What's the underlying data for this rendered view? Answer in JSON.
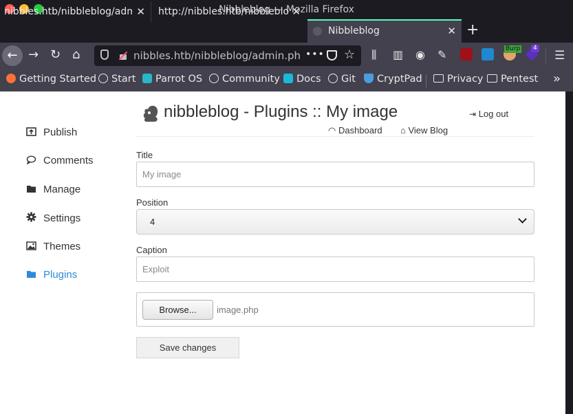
{
  "window": {
    "title": "Nibbleblog — Mozilla Firefox"
  },
  "tabs": [
    {
      "label": "nibbles.htb/nibbleblog/admin.php"
    },
    {
      "label": "http://nibbles.htb/nibbleblog/admin.php"
    },
    {
      "label": "Nibbleblog",
      "active": true
    }
  ],
  "navbar": {
    "url": "nibbles.htb/nibbleblog/admin.php?controller=plugins&action=config&plugin=my_image",
    "more": "•••",
    "burp_label": "Burp",
    "ext_badge": "4"
  },
  "bookmarks": [
    {
      "label": "Getting Started",
      "icon": "firefox-icon"
    },
    {
      "label": "Start",
      "icon": "globe-icon"
    },
    {
      "label": "Parrot OS",
      "icon": "parrot-icon"
    },
    {
      "label": "Community",
      "icon": "globe-icon"
    },
    {
      "label": "Docs",
      "icon": "docs-icon"
    },
    {
      "label": "Git",
      "icon": "globe-icon"
    },
    {
      "label": "CryptPad",
      "icon": "cryptpad-icon"
    },
    {
      "label": "Privacy",
      "icon": "folder-icon"
    },
    {
      "label": "Pentest",
      "icon": "folder-icon"
    }
  ],
  "sidebar": {
    "items": [
      {
        "label": "Publish",
        "icon": "publish-icon"
      },
      {
        "label": "Comments",
        "icon": "comment-icon"
      },
      {
        "label": "Manage",
        "icon": "folder-icon"
      },
      {
        "label": "Settings",
        "icon": "gear-icon"
      },
      {
        "label": "Themes",
        "icon": "image-icon"
      },
      {
        "label": "Plugins",
        "icon": "folder-icon",
        "active": true
      }
    ],
    "active_color": "#2e8ad8"
  },
  "header": {
    "title": "nibbleblog - Plugins :: My image",
    "logout": "Log out",
    "dashboard": "Dashboard",
    "view_blog": "View Blog"
  },
  "form": {
    "title_label": "Title",
    "title_value": "My image",
    "position_label": "Position",
    "position_value": "4",
    "caption_label": "Caption",
    "caption_value": "Exploit",
    "browse_label": "Browse...",
    "file_name": "image.php",
    "save_label": "Save changes"
  }
}
